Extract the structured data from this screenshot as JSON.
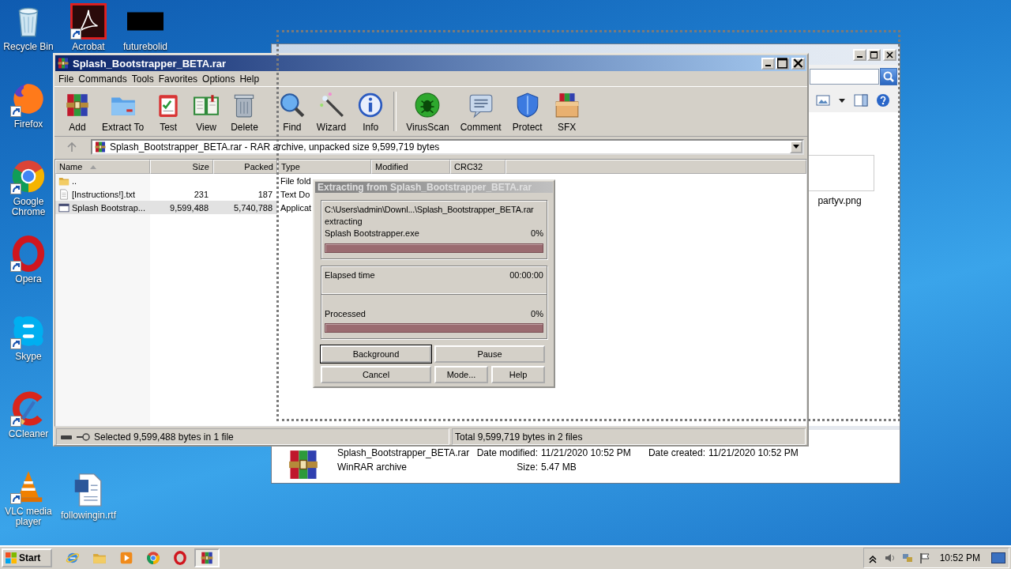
{
  "desktop": {
    "icons": [
      {
        "label": "Recycle Bin",
        "kind": "recycle",
        "shortcut": false
      },
      {
        "label": "Firefox",
        "kind": "firefox",
        "shortcut": true
      },
      {
        "label": "Google Chrome",
        "kind": "chrome",
        "shortcut": true
      },
      {
        "label": "Opera",
        "kind": "opera",
        "shortcut": true
      },
      {
        "label": "Skype",
        "kind": "skype",
        "shortcut": true
      },
      {
        "label": "CCleaner",
        "kind": "ccleaner",
        "shortcut": true
      },
      {
        "label": "VLC media player",
        "kind": "vlc",
        "shortcut": true
      },
      {
        "label": "Acrobat",
        "kind": "acrobat",
        "shortcut": true
      },
      {
        "label": "futurebolid",
        "kind": "blank",
        "shortcut": false
      },
      {
        "label": "followingin.rtf",
        "kind": "word",
        "shortcut": false
      }
    ]
  },
  "explorer_window": {
    "files": [
      {
        "name": "partyv.png"
      }
    ],
    "details": {
      "name": "Splash_Bootstrapper_BETA.rar",
      "type": "WinRAR archive",
      "fields": [
        {
          "label": "Date modified:",
          "value": "11/21/2020 10:52 PM"
        },
        {
          "label": "Date created:",
          "value": "11/21/2020 10:52 PM"
        },
        {
          "label": "Size:",
          "value": "5.47 MB"
        }
      ]
    }
  },
  "archive_window": {
    "title": "Splash_Bootstrapper_BETA.rar",
    "menu": [
      "File",
      "Commands",
      "Tools",
      "Favorites",
      "Options",
      "Help"
    ],
    "toolbar": [
      {
        "label": "Add",
        "kind": "add",
        "separator_before": false
      },
      {
        "label": "Extract To",
        "kind": "extract",
        "separator_before": false
      },
      {
        "label": "Test",
        "kind": "test",
        "separator_before": false
      },
      {
        "label": "View",
        "kind": "view",
        "separator_before": false
      },
      {
        "label": "Delete",
        "kind": "delete",
        "separator_before": false
      },
      {
        "label": "Find",
        "kind": "find",
        "separator_before": false
      },
      {
        "label": "Wizard",
        "kind": "wizard",
        "separator_before": false
      },
      {
        "label": "Info",
        "kind": "info",
        "separator_before": false
      },
      {
        "label": "VirusScan",
        "kind": "virusscan",
        "separator_before": true
      },
      {
        "label": "Comment",
        "kind": "comment",
        "separator_before": false
      },
      {
        "label": "Protect",
        "kind": "protect",
        "separator_before": false
      },
      {
        "label": "SFX",
        "kind": "sfx",
        "separator_before": false
      }
    ],
    "address": "Splash_Bootstrapper_BETA.rar - RAR archive, unpacked size 9,599,719 bytes",
    "columns": [
      {
        "label": "Name",
        "sorted": true
      },
      {
        "label": "Size",
        "sorted": false
      },
      {
        "label": "Packed",
        "sorted": false
      },
      {
        "label": "Type",
        "sorted": false
      },
      {
        "label": "Modified",
        "sorted": false
      },
      {
        "label": "CRC32",
        "sorted": false
      }
    ],
    "rows": [
      {
        "name": "..",
        "kind": "folder",
        "type": "File fold",
        "selected": false
      },
      {
        "name": "[Instructions!].txt",
        "kind": "text",
        "size": "231",
        "packed": "187",
        "type": "Text Do",
        "selected": false
      },
      {
        "name": "Splash Bootstrap...",
        "kind": "app",
        "size": "9,599,488",
        "packed": "5,740,788",
        "type": "Applicat",
        "selected": true
      }
    ],
    "status": {
      "selected": "Selected 9,599,488 bytes in 1 file",
      "total": "Total 9,599,719 bytes in 2 files"
    }
  },
  "dialog": {
    "title": "Extracting from Splash_Bootstrapper_BETA.rar",
    "archive": "C:\\Users\\admin\\Downl...\\Splash_Bootstrapper_BETA.rar",
    "action": "extracting",
    "file": "Splash Bootstrapper.exe",
    "file_percent": "0%",
    "file_progress": {
      "level": 0
    },
    "elapsed_label": "Elapsed time",
    "elapsed": "00:00:00",
    "processed_label": "Processed",
    "processed_percent": "0%",
    "processed_progress": {
      "level": 0
    },
    "buttons": [
      {
        "label": "Background",
        "default": true
      },
      {
        "label": "Pause",
        "default": false
      },
      {
        "label": "Cancel",
        "default": false
      },
      {
        "label": "Mode...",
        "default": false
      },
      {
        "label": "Help",
        "default": false
      }
    ]
  },
  "taskbar": {
    "start": "Start",
    "apps": [
      {
        "kind": "ie",
        "active": false
      },
      {
        "kind": "explorer",
        "active": false
      },
      {
        "kind": "media",
        "active": false
      },
      {
        "kind": "chrome",
        "active": false
      },
      {
        "kind": "opera",
        "active": false
      },
      {
        "kind": "winrar",
        "active": true
      }
    ],
    "clock": "10:52 PM"
  }
}
